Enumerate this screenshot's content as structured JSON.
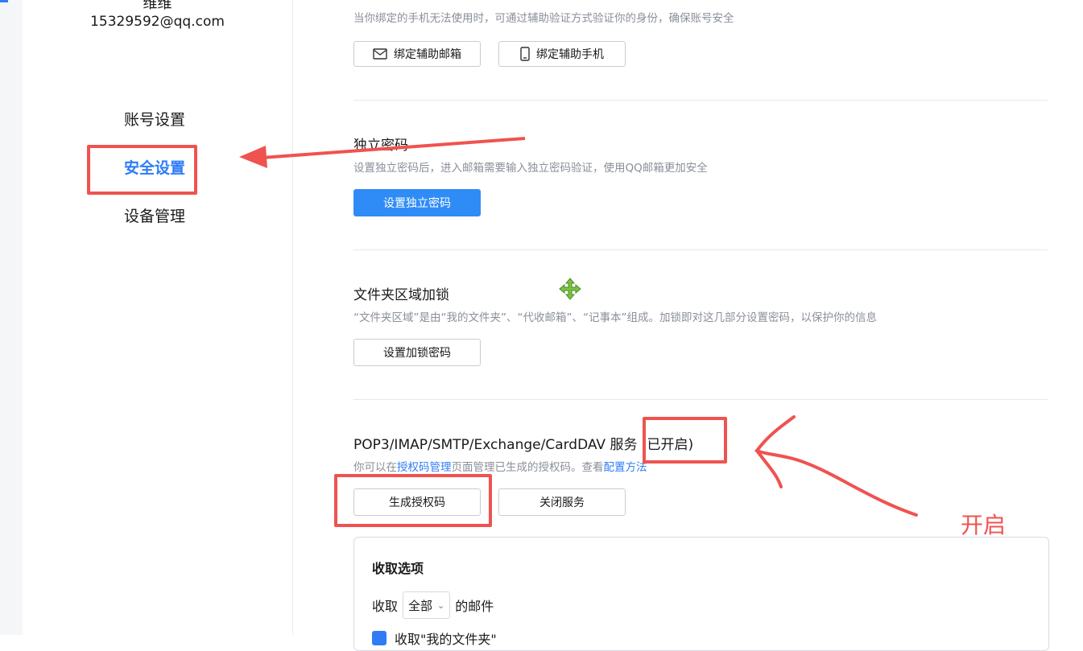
{
  "user": {
    "name": "维维",
    "email": "15329592@qq.com"
  },
  "sidebar": {
    "items": [
      {
        "label": "账号设置"
      },
      {
        "label": "安全设置"
      },
      {
        "label": "设备管理"
      }
    ]
  },
  "sections": {
    "aux_verify": {
      "desc": "当你绑定的手机无法使用时，可通过辅助验证方式验证你的身份，确保账号安全",
      "bind_email_label": "绑定辅助邮箱",
      "bind_phone_label": "绑定辅助手机"
    },
    "independent_password": {
      "title": "独立密码",
      "desc": "设置独立密码后，进入邮箱需要输入独立密码验证，使用QQ邮箱更加安全",
      "button_label": "设置独立密码"
    },
    "folder_lock": {
      "title": "文件夹区域加锁",
      "desc": "“文件夹区域”是由“我的文件夹”、“代收邮箱”、“记事本”组成。加锁即对这几部分设置密码，以保护你的信息",
      "button_label": "设置加锁密码"
    },
    "pop3": {
      "title": "POP3/IMAP/SMTP/Exchange/CardDAV 服务",
      "status": "(已开启)",
      "desc_prefix": "你可以在",
      "desc_link1": "授权码管理",
      "desc_middle": "页面管理已生成的授权码。查看",
      "desc_link2": "配置方法",
      "generate_label": "生成授权码",
      "close_label": "关闭服务"
    }
  },
  "receive_options": {
    "title": "收取选项",
    "prefix": "收取",
    "selected": "全部",
    "suffix": "的邮件",
    "checkbox_label": "收取\"我的文件夹\""
  },
  "annotation": {
    "label": "开启",
    "color": "#ef5350"
  },
  "colors": {
    "accent": "#2f7cf6",
    "primary_button": "#2f8cf6"
  }
}
